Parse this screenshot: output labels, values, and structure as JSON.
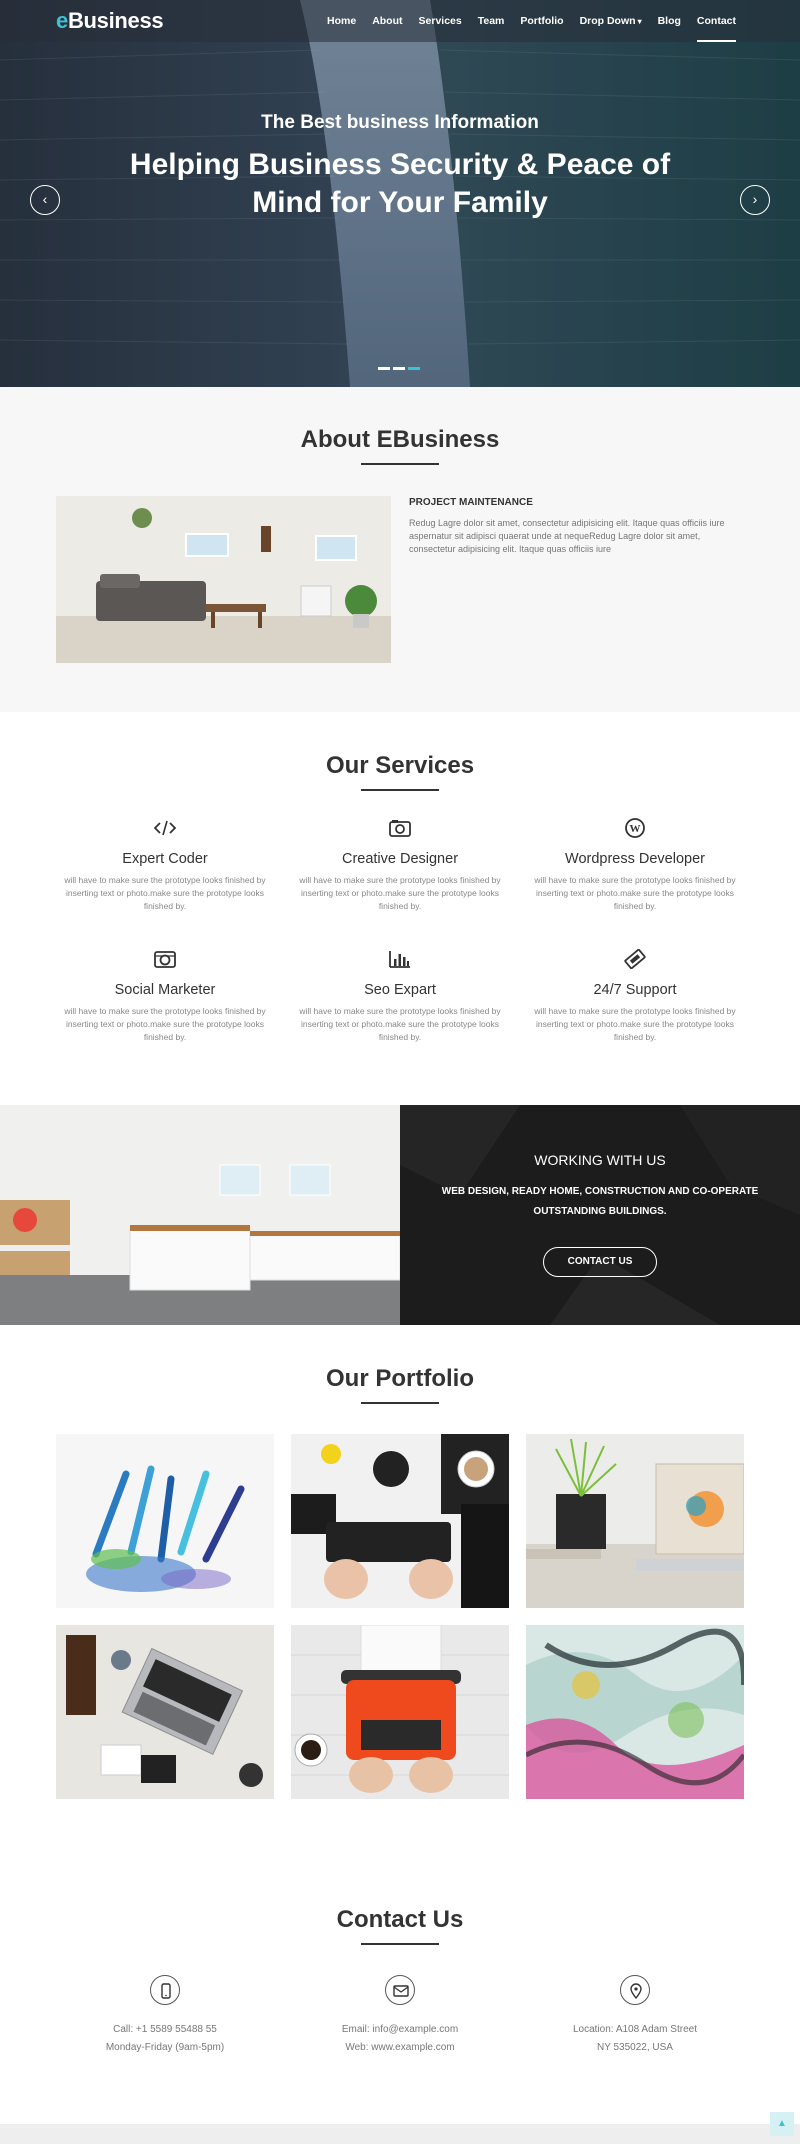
{
  "brand": {
    "logo_accent": "e",
    "logo_rest": "Business",
    "accent_color": "#3ec1d3"
  },
  "nav": {
    "items": [
      {
        "label": "Home"
      },
      {
        "label": "About"
      },
      {
        "label": "Services"
      },
      {
        "label": "Team"
      },
      {
        "label": "Portfolio"
      },
      {
        "label": "Drop Down"
      },
      {
        "label": "Blog"
      },
      {
        "label": "Contact"
      }
    ],
    "active": "Contact"
  },
  "hero": {
    "subtitle": "The Best business Information",
    "title": "Helping Business Security & Peace of Mind for Your Family",
    "prev_icon": "chevron-left-icon",
    "next_icon": "chevron-right-icon",
    "slides": 3,
    "active_slide": 3
  },
  "about": {
    "title": "About EBusiness",
    "heading": "PROJECT MAINTENANCE",
    "text": "Redug Lagre dolor sit amet, consectetur adipisicing elit. Itaque quas officiis iure aspernatur sit adipisci quaerat unde at nequeRedug Lagre dolor sit amet, consectetur adipisicing elit. Itaque quas officiis iure"
  },
  "services": {
    "title": "Our Services",
    "items": [
      {
        "name": "Expert Coder",
        "icon": "code-icon",
        "desc": "will have to make sure the prototype looks finished by inserting text or photo.make sure the prototype looks finished by."
      },
      {
        "name": "Creative Designer",
        "icon": "camera-icon",
        "desc": "will have to make sure the prototype looks finished by inserting text or photo.make sure the prototype looks finished by."
      },
      {
        "name": "Wordpress Developer",
        "icon": "wordpress-icon",
        "desc": "will have to make sure the prototype looks finished by inserting text or photo.make sure the prototype looks finished by."
      },
      {
        "name": "Social Marketer",
        "icon": "camera-retro-icon",
        "desc": "will have to make sure the prototype looks finished by inserting text or photo.make sure the prototype looks finished by."
      },
      {
        "name": "Seo Expart",
        "icon": "bar-chart-icon",
        "desc": "will have to make sure the prototype looks finished by inserting text or photo.make sure the prototype looks finished by."
      },
      {
        "name": "24/7 Support",
        "icon": "ticket-icon",
        "desc": "will have to make sure the prototype looks finished by inserting text or photo.make sure the prototype looks finished by."
      }
    ]
  },
  "working": {
    "title": "WORKING WITH US",
    "text": "WEB DESIGN, READY HOME, CONSTRUCTION AND CO-OPERATE OUTSTANDING BUILDINGS.",
    "button": "CONTACT US"
  },
  "portfolio": {
    "title": "Our Portfolio",
    "items": [
      {
        "subject": "colored pencils"
      },
      {
        "subject": "keyboard on desk"
      },
      {
        "subject": "plant and laptop"
      },
      {
        "subject": "laptop top view"
      },
      {
        "subject": "orange typewriter"
      },
      {
        "subject": "abstract paint"
      }
    ]
  },
  "contact": {
    "title": "Contact Us",
    "items": [
      {
        "icon": "mobile-icon",
        "line1": "Call: +1 5589 55488 55",
        "line2": "Monday-Friday (9am-5pm)"
      },
      {
        "icon": "envelope-icon",
        "line1": "Email: info@example.com",
        "line2": "Web: www.example.com"
      },
      {
        "icon": "map-pin-icon",
        "line1": "Location: A108 Adam Street",
        "line2": "NY 535022, USA"
      }
    ]
  },
  "back_to_top_icon": "arrow-up-icon"
}
